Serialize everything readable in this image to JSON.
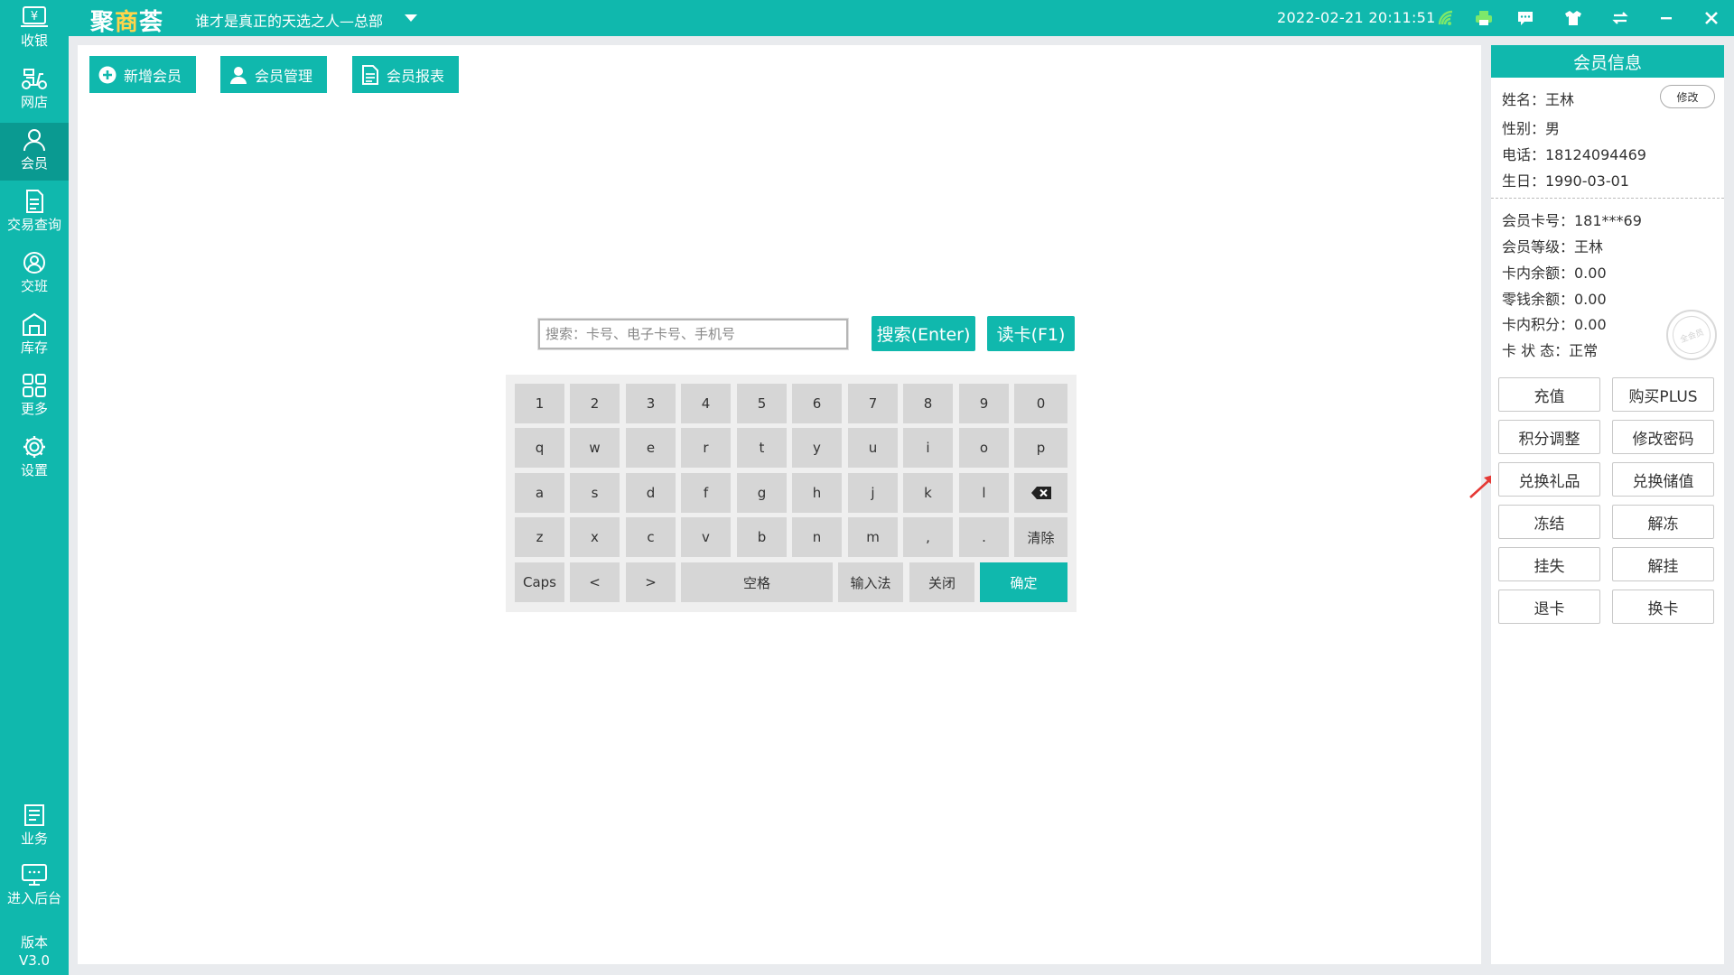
{
  "app": {
    "logo_pre": "聚",
    "logo_accent": "商",
    "logo_post": "荟",
    "store_name": "谁才是真正的天选之人—总部",
    "datetime": "2022-02-21 20:11:51",
    "brand_color": "#10b8ad",
    "version_label": "版本",
    "version": "V3.0"
  },
  "topbar_icons": [
    "wifi-icon",
    "printer-icon",
    "message-icon",
    "shirt-icon",
    "switch-icon",
    "minimize-icon",
    "close-icon"
  ],
  "sidebar": {
    "items": [
      {
        "label": "收银",
        "icon": "cash-register-icon"
      },
      {
        "label": "网店",
        "icon": "scooter-icon"
      },
      {
        "label": "会员",
        "icon": "member-icon",
        "active": true
      },
      {
        "label": "交易查询",
        "icon": "document-icon"
      },
      {
        "label": "交班",
        "icon": "shift-icon"
      },
      {
        "label": "库存",
        "icon": "warehouse-icon"
      },
      {
        "label": "更多",
        "icon": "grid-icon"
      },
      {
        "label": "设置",
        "icon": "gear-icon"
      },
      {
        "label": "业务",
        "icon": "business-icon"
      },
      {
        "label": "进入后台",
        "icon": "monitor-icon"
      }
    ]
  },
  "toolbar": {
    "add_member": "新增会员",
    "manage_member": "会员管理",
    "member_report": "会员报表"
  },
  "search": {
    "placeholder": "搜索：卡号、电子卡号、手机号",
    "search_btn": "搜索(Enter)",
    "read_card_btn": "读卡(F1)"
  },
  "keyboard": {
    "row1": [
      "1",
      "2",
      "3",
      "4",
      "5",
      "6",
      "7",
      "8",
      "9",
      "0"
    ],
    "row2": [
      "q",
      "w",
      "e",
      "r",
      "t",
      "y",
      "u",
      "i",
      "o",
      "p"
    ],
    "row3": [
      "a",
      "s",
      "d",
      "f",
      "g",
      "h",
      "j",
      "k",
      "l"
    ],
    "row4": [
      "z",
      "x",
      "c",
      "v",
      "b",
      "n",
      "m",
      ",",
      "."
    ],
    "clear": "清除",
    "caps": "Caps",
    "left": "<",
    "right": ">",
    "space": "空格",
    "ime": "输入法",
    "close": "关闭",
    "confirm": "确定"
  },
  "member": {
    "header": "会员信息",
    "edit": "修改",
    "name": "姓名：王林",
    "gender": "性别：男",
    "phone": "电话：18124094469",
    "birthday": "生日：1990-03-01",
    "card_no": "会员卡号：181***69",
    "level": "会员等级：王林",
    "balance": "卡内余额：0.00",
    "change_balance": "零钱余额：0.00",
    "points": "卡内积分：0.00",
    "status": "卡 状 态：正常",
    "stamp_text": "全会员"
  },
  "actions": {
    "recharge": "充值",
    "buy_plus": "购买PLUS",
    "points_adjust": "积分调整",
    "change_password": "修改密码",
    "redeem_gift": "兑换礼品",
    "redeem_value": "兑换储值",
    "freeze": "冻结",
    "unfreeze": "解冻",
    "report_loss": "挂失",
    "cancel_loss": "解挂",
    "return_card": "退卡",
    "replace_card": "换卡"
  }
}
